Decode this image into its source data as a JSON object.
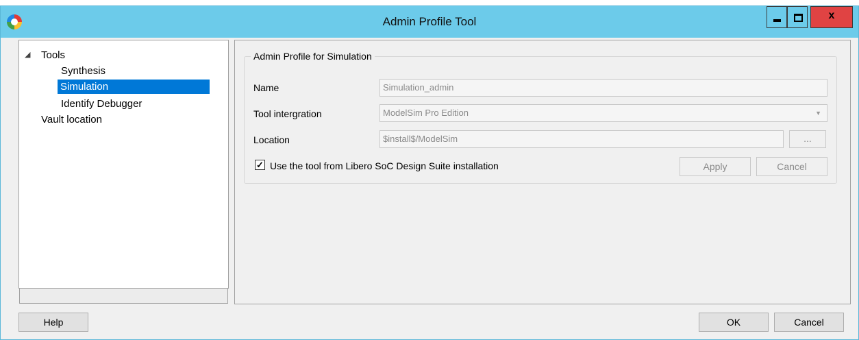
{
  "window": {
    "title": "Admin Profile Tool",
    "close_glyph": "x"
  },
  "tree": {
    "expander_icon": "◢",
    "root": "Tools",
    "children": [
      "Synthesis",
      "Simulation",
      "Identify Debugger"
    ],
    "selected": "Simulation",
    "other": "Vault location"
  },
  "profile": {
    "group_title": "Admin Profile for Simulation",
    "name_label": "Name",
    "name_value": "Simulation_admin",
    "tool_label": "Tool intergration",
    "tool_value": "ModelSim Pro Edition",
    "location_label": "Location",
    "location_value": "$install$/ModelSim",
    "browse_label": "...",
    "use_tool_label": "Use the tool from Libero SoC Design Suite installation",
    "use_tool_checked": true,
    "apply_label": "Apply",
    "cancel_label": "Cancel"
  },
  "footer": {
    "help_label": "Help",
    "ok_label": "OK",
    "cancel_label": "Cancel"
  },
  "colors": {
    "titlebar": "#6ccbea",
    "selection": "#0078d7",
    "close": "#e04343"
  }
}
